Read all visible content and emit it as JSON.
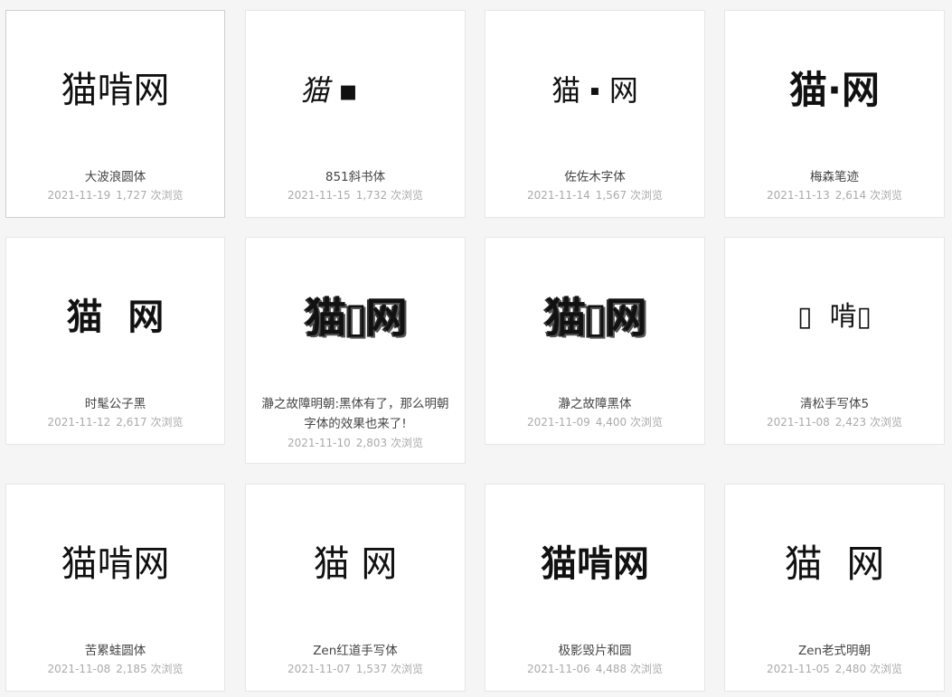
{
  "cards": [
    {
      "preview": "猫啃网",
      "title": "大波浪圆体",
      "date": "2021-11-19",
      "views": "1,727 次浏览"
    },
    {
      "preview": "猫 ▪",
      "title": "851斜书体",
      "date": "2021-11-15",
      "views": "1,732 次浏览"
    },
    {
      "preview": "猫 ▪ 网",
      "title": "佐佐木字体",
      "date": "2021-11-14",
      "views": "1,567 次浏览"
    },
    {
      "preview": "猫·网",
      "title": "梅森笔迹",
      "date": "2021-11-13",
      "views": "2,614 次浏览"
    },
    {
      "preview": "猫  网",
      "title": "时髦公子黑",
      "date": "2021-11-12",
      "views": "2,617 次浏览"
    },
    {
      "preview": "猫▯网",
      "title": "瀞之故障明朝:黑体有了，那么明朝字体的效果也来了!",
      "date": "2021-11-10",
      "views": "2,803 次浏览"
    },
    {
      "preview": "猫▯网",
      "title": "瀞之故障黑体",
      "date": "2021-11-09",
      "views": "4,400 次浏览"
    },
    {
      "preview": "▯  啃▯",
      "title": "清松手写体5",
      "date": "2021-11-08",
      "views": "2,423 次浏览"
    },
    {
      "preview": "猫啃网",
      "title": "苦累蛙圆体",
      "date": "2021-11-08",
      "views": "2,185 次浏览"
    },
    {
      "preview": "猫 网",
      "title": "Zen红道手写体",
      "date": "2021-11-07",
      "views": "1,537 次浏览"
    },
    {
      "preview": "猫啃网",
      "title": "极影毁片和圆",
      "date": "2021-11-06",
      "views": "4,488 次浏览"
    },
    {
      "preview": "猫  网",
      "title": "Zen老式明朝",
      "date": "2021-11-05",
      "views": "2,480 次浏览"
    }
  ]
}
